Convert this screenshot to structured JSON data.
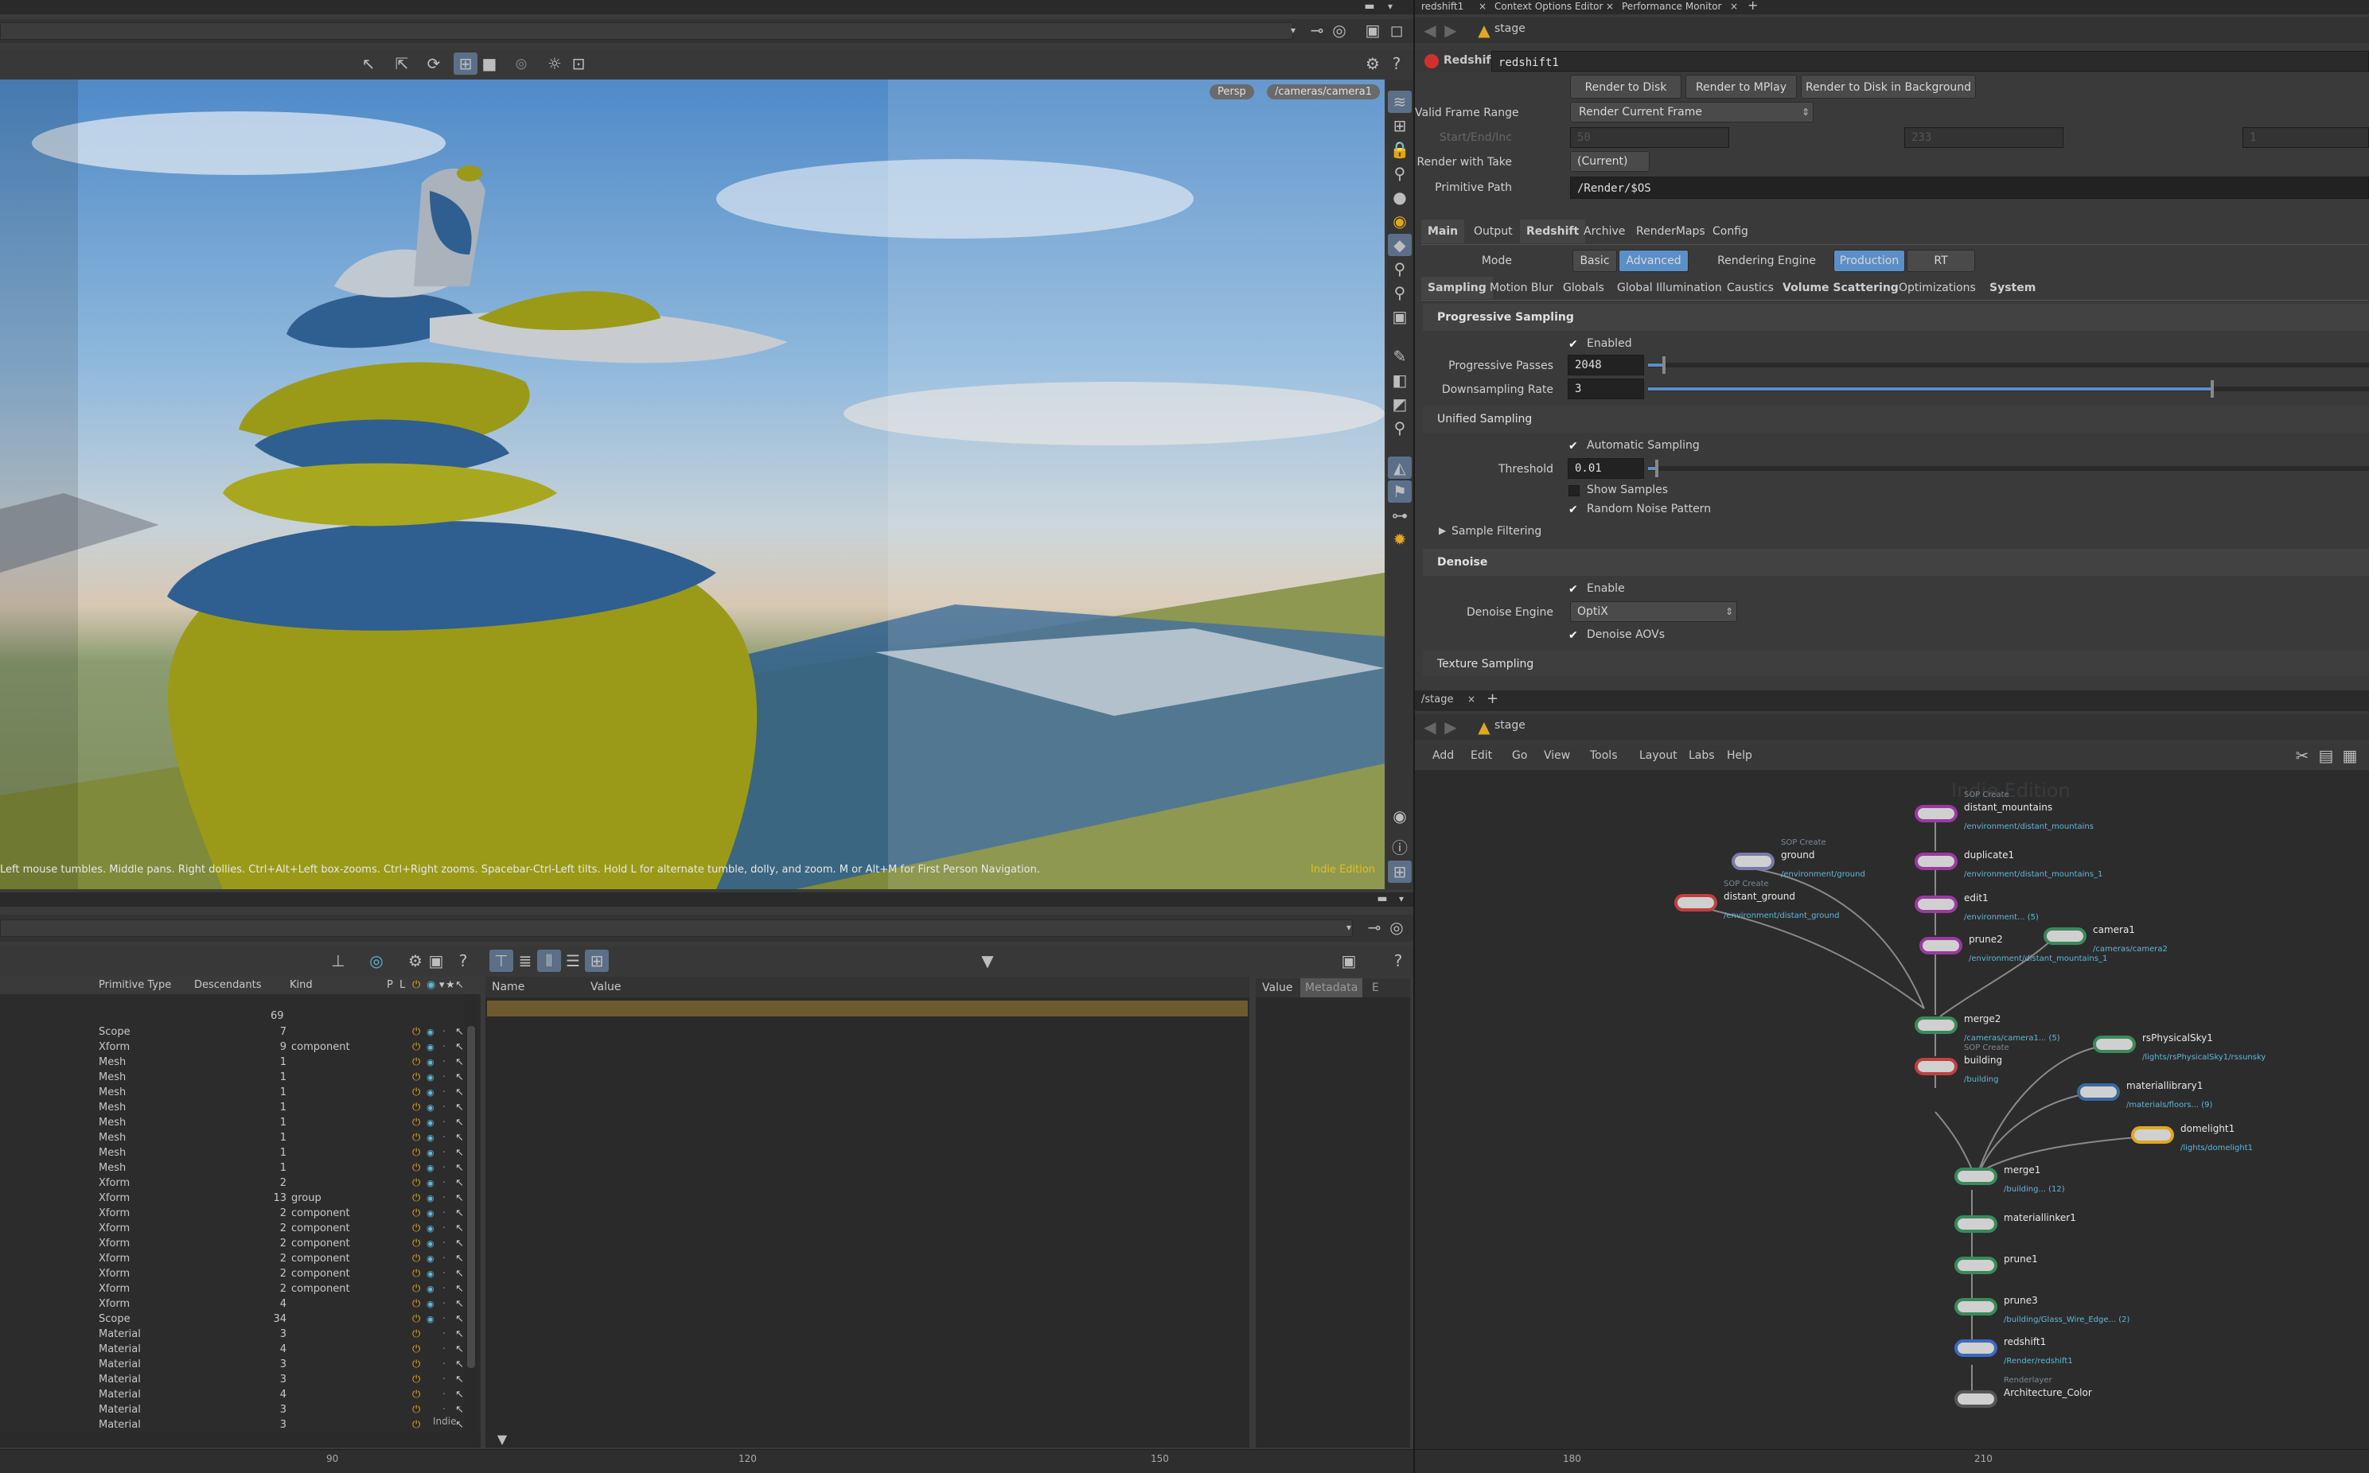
{
  "colors": {
    "accent": "#5b8fc7",
    "gold": "#e0a820",
    "panel": "#3a3a3a",
    "dark": "#2b2b2b",
    "indie": "#e0c020"
  },
  "viewport": {
    "persp": "Persp",
    "camera": "/cameras/camera1",
    "edition": "Indie Edition",
    "status": "Left mouse tumbles. Middle pans. Right dollies. Ctrl+Alt+Left box-zooms. Ctrl+Right zooms. Spacebar-Ctrl-Left tilts. Hold L for alternate tumble, dolly, and zoom. M or Alt+M for First Person Navigation."
  },
  "scene_graph": {
    "columns": [
      "Primitive Type",
      "Descendants",
      "Kind",
      "P",
      "L"
    ],
    "total": "69",
    "rows": [
      {
        "type": "Scope",
        "desc": "7",
        "kind": ""
      },
      {
        "type": "Xform",
        "desc": "9",
        "kind": "component"
      },
      {
        "type": "Mesh",
        "desc": "1",
        "kind": ""
      },
      {
        "type": "Mesh",
        "desc": "1",
        "kind": ""
      },
      {
        "type": "Mesh",
        "desc": "1",
        "kind": ""
      },
      {
        "type": "Mesh",
        "desc": "1",
        "kind": ""
      },
      {
        "type": "Mesh",
        "desc": "1",
        "kind": ""
      },
      {
        "type": "Mesh",
        "desc": "1",
        "kind": ""
      },
      {
        "type": "Mesh",
        "desc": "1",
        "kind": ""
      },
      {
        "type": "Mesh",
        "desc": "1",
        "kind": ""
      },
      {
        "type": "Xform",
        "desc": "2",
        "kind": ""
      },
      {
        "type": "Xform",
        "desc": "13",
        "kind": "group"
      },
      {
        "type": "Xform",
        "desc": "2",
        "kind": "component"
      },
      {
        "type": "Xform",
        "desc": "2",
        "kind": "component"
      },
      {
        "type": "Xform",
        "desc": "2",
        "kind": "component"
      },
      {
        "type": "Xform",
        "desc": "2",
        "kind": "component"
      },
      {
        "type": "Xform",
        "desc": "2",
        "kind": "component"
      },
      {
        "type": "Xform",
        "desc": "2",
        "kind": "component"
      },
      {
        "type": "Xform",
        "desc": "4",
        "kind": ""
      },
      {
        "type": "Scope",
        "desc": "34",
        "kind": ""
      },
      {
        "type": "Material",
        "desc": "3",
        "kind": ""
      },
      {
        "type": "Material",
        "desc": "4",
        "kind": ""
      },
      {
        "type": "Material",
        "desc": "3",
        "kind": ""
      },
      {
        "type": "Material",
        "desc": "3",
        "kind": ""
      },
      {
        "type": "Material",
        "desc": "4",
        "kind": ""
      },
      {
        "type": "Material",
        "desc": "3",
        "kind": ""
      },
      {
        "type": "Material",
        "desc": "3",
        "kind": ""
      }
    ],
    "indie": "Indie"
  },
  "details": {
    "name": "Name",
    "value": "Value",
    "tab_value": "Value",
    "tab_meta": "Metadata",
    "tab_e": "E"
  },
  "timeline": {
    "ticks": [
      "90",
      "120",
      "150",
      "180",
      "210"
    ]
  },
  "top_tabs": [
    "redshift1",
    "Context Options Editor",
    "Performance Monitor"
  ],
  "params": {
    "path": "stage",
    "node_type": "Redshift",
    "node_name": "redshift1",
    "btn_disk": "Render to Disk",
    "btn_mplay": "Render to MPlay",
    "btn_bg": "Render to Disk in Background",
    "valid_range_label": "Valid Frame Range",
    "valid_range": "Render Current Frame",
    "start_label": "Start/End/Inc",
    "start": "50",
    "end": "233",
    "inc": "1",
    "take_label": "Render with Take",
    "take": "(Current)",
    "prim_label": "Primitive Path",
    "prim": "/Render/$OS",
    "tabs": [
      "Main",
      "Output",
      "Redshift",
      "Archive",
      "RenderMaps",
      "Config"
    ],
    "mode_label": "Mode",
    "mode_basic": "Basic",
    "mode_adv": "Advanced",
    "engine_label": "Rendering Engine",
    "engine_prod": "Production",
    "engine_rt": "RT",
    "subtabs": [
      "Sampling",
      "Motion Blur",
      "Globals",
      "Global Illumination",
      "Caustics",
      "Volume Scattering",
      "Optimizations",
      "System"
    ],
    "prog_header": "Progressive Sampling",
    "enabled": "Enabled",
    "passes_label": "Progressive Passes",
    "passes": "2048",
    "passes_frac": 0.02,
    "down_label": "Downsampling Rate",
    "down": "3",
    "down_frac": 0.78,
    "unified": "Unified Sampling",
    "auto": "Automatic Sampling",
    "thresh_label": "Threshold",
    "thresh": "0.01",
    "thresh_frac": 0.01,
    "show_samples": "Show Samples",
    "random_noise": "Random Noise Pattern",
    "sample_filter": "Sample Filtering",
    "denoise_header": "Denoise",
    "denoise_enable": "Enable",
    "denoise_engine_label": "Denoise Engine",
    "denoise_engine": "OptiX",
    "denoise_aovs": "Denoise AOVs",
    "texture": "Texture Sampling"
  },
  "network": {
    "path_tab": "/stage",
    "path": "stage",
    "menu": [
      "Add",
      "Edit",
      "Go",
      "View",
      "Tools",
      "Layout",
      "Labs",
      "Help"
    ],
    "watermark": "Indie Edition",
    "nodes": [
      {
        "name": "distant_mountains",
        "sub": "/environment/distant_mountains",
        "top": "SOP Create"
      },
      {
        "name": "ground",
        "sub": "/environment/ground",
        "top": "SOP Create"
      },
      {
        "name": "duplicate1",
        "sub": "/environment/distant_mountains_1",
        "top": ""
      },
      {
        "name": "distant_ground",
        "sub": "/environment/distant_ground",
        "top": "SOP Create"
      },
      {
        "name": "edit1",
        "sub": "/environment... (5)",
        "top": ""
      },
      {
        "name": "prune2",
        "sub": "/environment/distant_mountains_1",
        "top": ""
      },
      {
        "name": "camera1",
        "sub": "/cameras/camera2",
        "top": ""
      },
      {
        "name": "merge2",
        "sub": "/cameras/camera1... (5)",
        "top": ""
      },
      {
        "name": "rsPhysicalSky1",
        "sub": "/lights/rsPhysicalSky1/rssunsky",
        "top": ""
      },
      {
        "name": "building",
        "sub": "/building",
        "top": "SOP Create"
      },
      {
        "name": "materiallibrary1",
        "sub": "/materials/floors... (9)",
        "top": ""
      },
      {
        "name": "domelight1",
        "sub": "/lights/domelight1",
        "top": ""
      },
      {
        "name": "merge1",
        "sub": "/building... (12)",
        "top": ""
      },
      {
        "name": "materiallinker1",
        "sub": "",
        "top": ""
      },
      {
        "name": "prune1",
        "sub": "",
        "top": ""
      },
      {
        "name": "prune3",
        "sub": "/building/Glass_Wire_Edge... (2)",
        "top": ""
      },
      {
        "name": "redshift1",
        "sub": "/Render/redshift1",
        "top": ""
      },
      {
        "name": "Architecture_Color",
        "sub": "",
        "top": "Renderlayer"
      }
    ]
  }
}
